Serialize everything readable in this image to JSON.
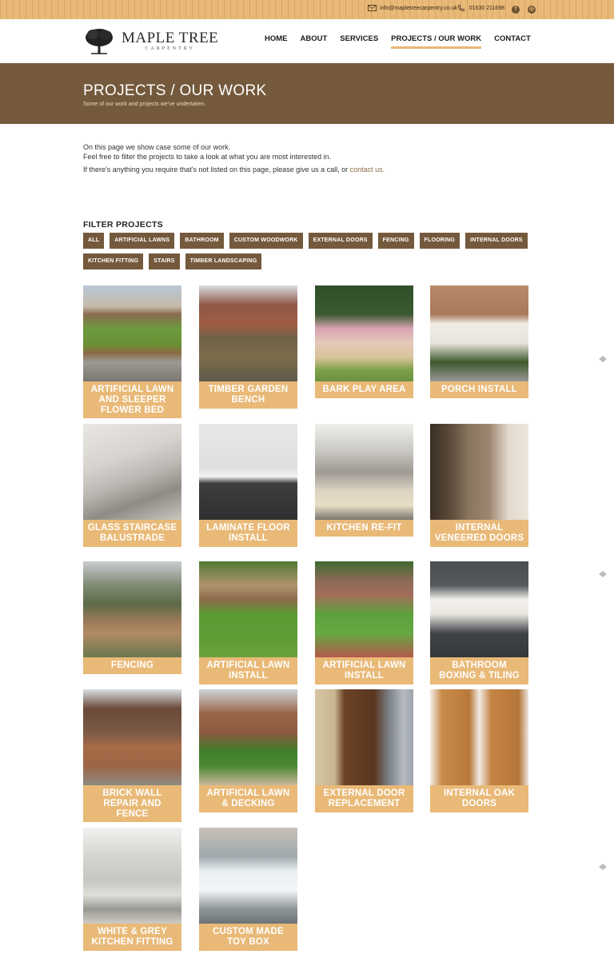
{
  "topbar": {
    "email": "info@mapletreecarpentry.co.uk",
    "phone": "01630 211698",
    "social": [
      "f",
      "◎"
    ]
  },
  "logo": {
    "brand": "MAPLE TREE",
    "sub": "CARPENTRY"
  },
  "nav": [
    "HOME",
    "ABOUT",
    "SERVICES",
    "PROJECTS / OUR WORK",
    "CONTACT"
  ],
  "page": {
    "title": "PROJECTS / OUR WORK",
    "subtitle": "Some of our work and projects we've undertaken."
  },
  "intro": {
    "line1": "On this page we show case some of our work.",
    "line2": "Feel free to filter the projects to take a look at what you are most interested in.",
    "line3": "If there's anything you require that's not listed on this page, please give us a call, or ",
    "link": "contact us."
  },
  "filters": {
    "title": "FILTER PROJECTS",
    "items": [
      "ALL",
      "ARTIFICIAL LAWNS",
      "BATHROOM",
      "CUSTOM WOODWORK",
      "EXTERNAL DOORS",
      "FENCING",
      "FLOORING",
      "INTERNAL DOORS",
      "KITCHEN FITTING",
      "STAIRS",
      "TIMBER LANDSCAPING"
    ]
  },
  "projects": [
    "ARTIFICIAL LAWN AND SLEEPER FLOWER BED",
    "TIMBER GARDEN BENCH",
    "BARK PLAY AREA",
    "PORCH INSTALL",
    "GLASS STAIRCASE BALUSTRADE",
    "LAMINATE FLOOR INSTALL",
    "KITCHEN RE-FIT",
    "INTERNAL VENEERED DOORS",
    "FENCING",
    "ARTIFICIAL LAWN INSTALL",
    "ARTIFICIAL LAWN INSTALL",
    "BATHROOM BOXING & TILING",
    "BRICK WALL REPAIR AND FENCE",
    "ARTIFICIAL LAWN & DECKING",
    "EXTERNAL DOOR REPLACEMENT",
    "INTERNAL OAK DOORS",
    "WHITE & GREY KITCHEN FITTING",
    "CUSTOM MADE TOY BOX"
  ],
  "colors": {
    "accent": "#e9b977",
    "brown": "#74593c"
  }
}
